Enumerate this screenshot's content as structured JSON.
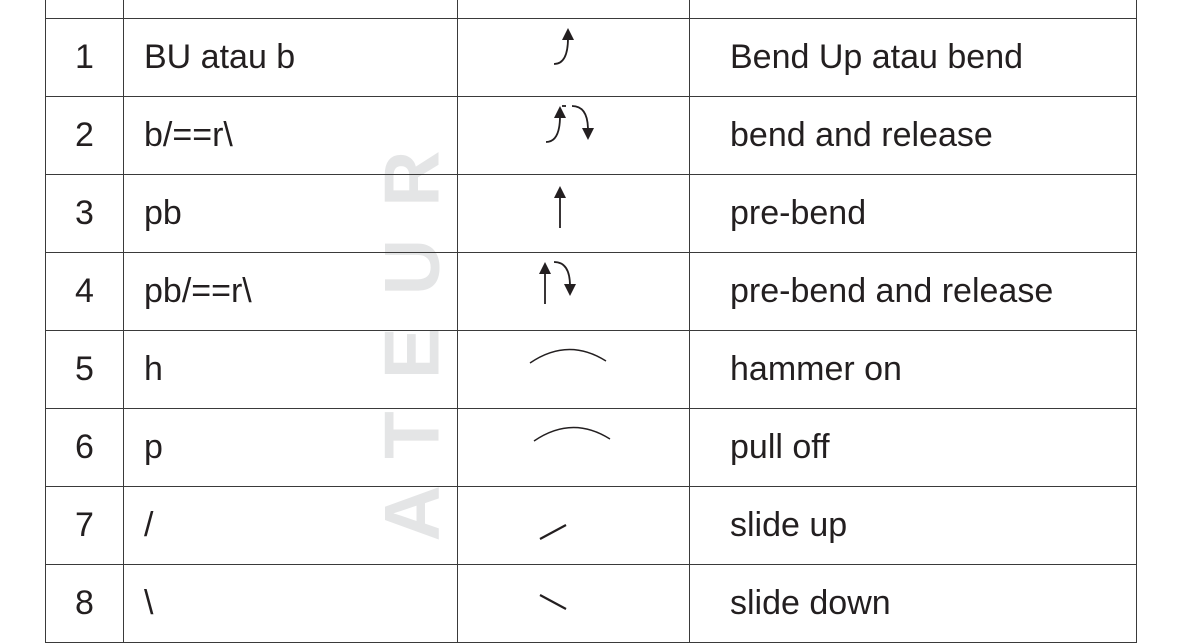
{
  "watermark": "ATEUR",
  "table": {
    "rows": [
      {
        "no": "1",
        "code": "BU atau b",
        "symbol": "bend-up-icon",
        "meaning": "Bend Up atau bend"
      },
      {
        "no": "2",
        "code": "b/==r\\",
        "symbol": "bend-release-icon",
        "meaning": "bend and release"
      },
      {
        "no": "3",
        "code": "pb",
        "symbol": "pre-bend-icon",
        "meaning": "pre-bend"
      },
      {
        "no": "4",
        "code": "pb/==r\\",
        "symbol": "pre-bend-release-icon",
        "meaning": "pre-bend and release"
      },
      {
        "no": "5",
        "code": "h",
        "symbol": "hammer-on-icon",
        "meaning": "hammer on"
      },
      {
        "no": "6",
        "code": "p",
        "symbol": "pull-off-icon",
        "meaning": "pull off"
      },
      {
        "no": "7",
        "code": "/",
        "symbol": "slide-up-icon",
        "meaning": "slide up"
      },
      {
        "no": "8",
        "code": "\\",
        "symbol": "slide-down-icon",
        "meaning": "slide down"
      }
    ]
  }
}
